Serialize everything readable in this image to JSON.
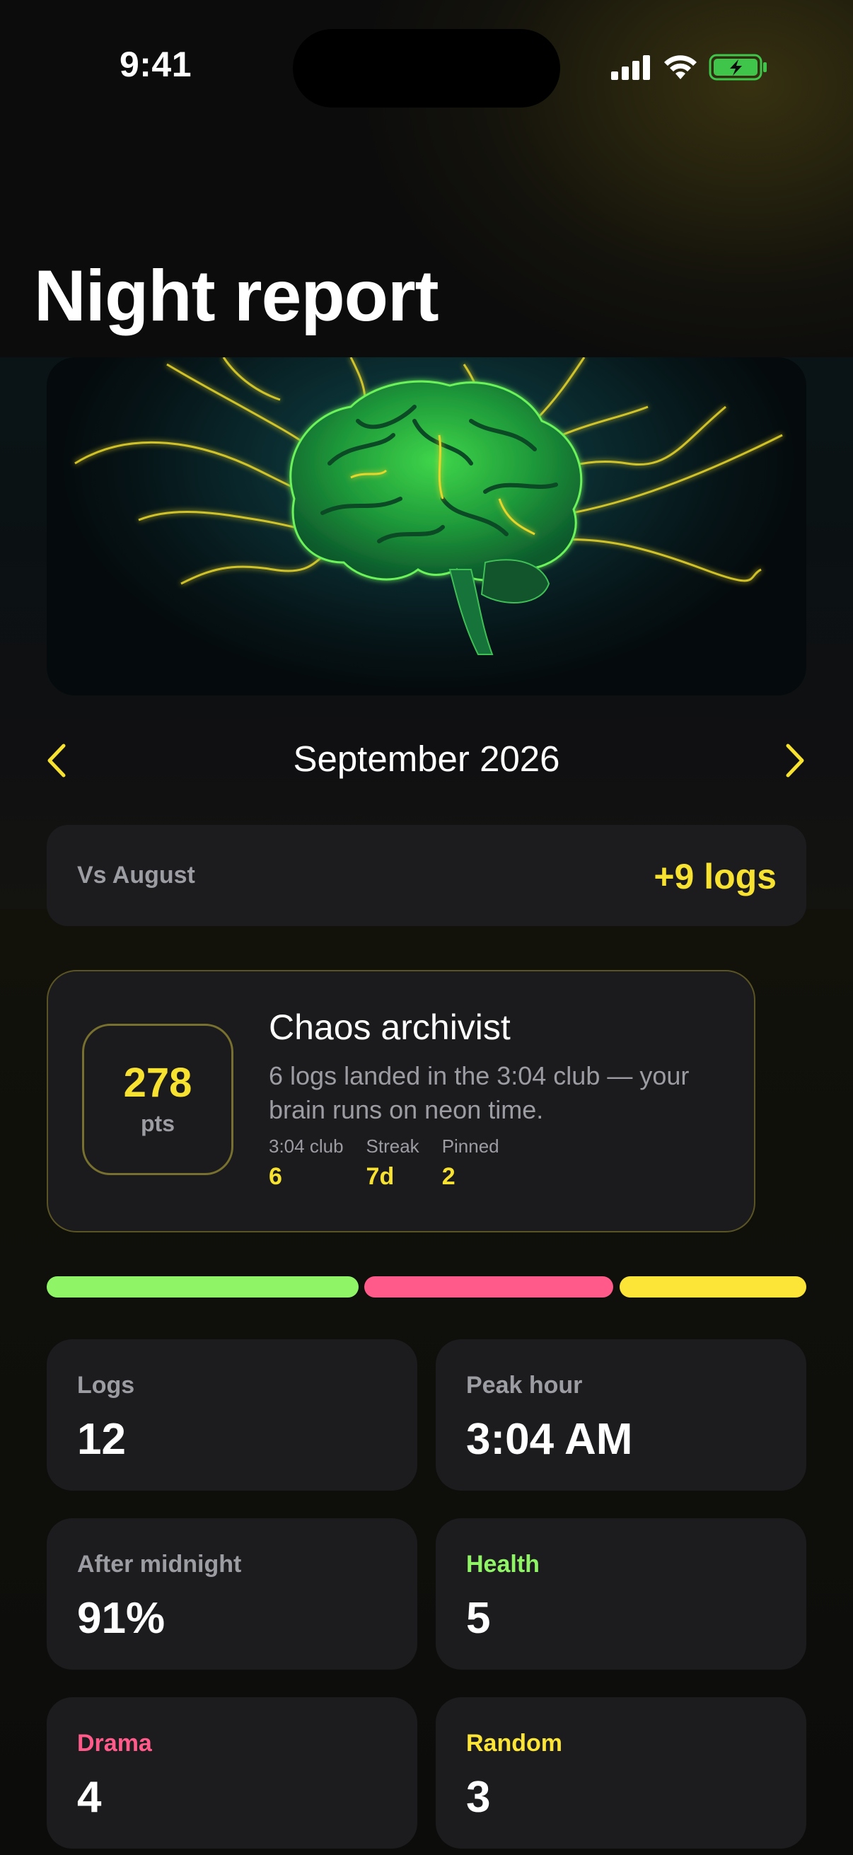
{
  "status_bar": {
    "time": "9:41",
    "icons": [
      "cellular-signal-icon",
      "wifi-icon",
      "battery-charging-icon"
    ],
    "battery_color": "#3ec54a"
  },
  "header": {
    "title": "Night report"
  },
  "hero": {
    "image": "glowing-brain-illustration"
  },
  "month_nav": {
    "title": "September 2026",
    "prev_icon": "chevron-left-icon",
    "next_icon": "chevron-right-icon",
    "accent_color": "#f8e231"
  },
  "compare": {
    "label": "Vs August",
    "value": "+9 logs"
  },
  "badge": {
    "points": "278",
    "points_unit": "pts",
    "title": "Chaos archivist",
    "description": "6 logs landed in the 3:04 club — your brain runs on neon time.",
    "stats": [
      {
        "label": "3:04 club",
        "value": "6"
      },
      {
        "label": "Streak",
        "value": "7d"
      },
      {
        "label": "Pinned",
        "value": "2"
      }
    ]
  },
  "category_bar": {
    "segments": [
      {
        "category": "Health",
        "count": 5,
        "color": "#8ff566"
      },
      {
        "category": "Drama",
        "count": 4,
        "color": "#ff5a8a"
      },
      {
        "category": "Random",
        "count": 3,
        "color": "#fde537"
      }
    ]
  },
  "tiles": [
    {
      "label": "Logs",
      "value": "12",
      "label_color": "#9c9ca3"
    },
    {
      "label": "Peak hour",
      "value": "3:04 AM",
      "label_color": "#9c9ca3"
    },
    {
      "label": "After midnight",
      "value": "91%",
      "label_color": "#9c9ca3"
    },
    {
      "label": "Health",
      "value": "5",
      "label_color": "#8ff566"
    },
    {
      "label": "Drama",
      "value": "4",
      "label_color": "#ff5a8a"
    },
    {
      "label": "Random",
      "value": "3",
      "label_color": "#fde537"
    }
  ]
}
